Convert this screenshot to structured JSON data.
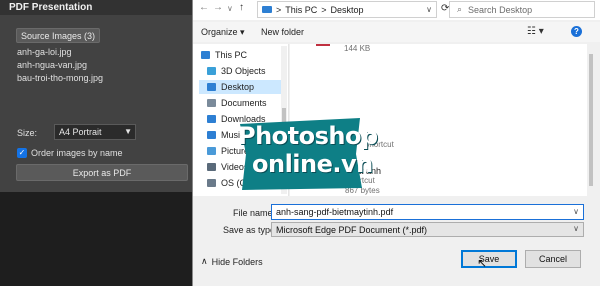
{
  "photoshop_panel": {
    "title": "PDF Presentation",
    "source_button": "Source Images (3)",
    "files": [
      "anh-ga-loi.jpg",
      "anh-ngua-van.jpg",
      "bau-troi-tho-mong.jpg"
    ],
    "size_label": "Size:",
    "size_value": "A4 Portrait",
    "order_label": "Order images by name",
    "order_checked": true,
    "export_button": "Export as PDF"
  },
  "dialog": {
    "address": {
      "segments": [
        "This PC",
        "Desktop"
      ],
      "separator": ">",
      "search_placeholder": "Search Desktop"
    },
    "toolbar": {
      "organize": "Organize ▾",
      "new_folder": "New folder"
    },
    "nav_items": [
      {
        "label": "This PC",
        "icon": "pc-icon",
        "color": "#2d7fd3"
      },
      {
        "label": "3D Objects",
        "icon": "cube-icon",
        "color": "#3aa0d8"
      },
      {
        "label": "Desktop",
        "icon": "desktop-icon",
        "color": "#2d7fd3",
        "selected": true
      },
      {
        "label": "Documents",
        "icon": "document-icon",
        "color": "#7a8a9a"
      },
      {
        "label": "Downloads",
        "icon": "download-icon",
        "color": "#2d7fd3"
      },
      {
        "label": "Music",
        "icon": "music-icon",
        "color": "#2d7fd3"
      },
      {
        "label": "Pictures",
        "icon": "picture-icon",
        "color": "#4a9ad8"
      },
      {
        "label": "Videos",
        "icon": "video-icon",
        "color": "#5a6a7a"
      },
      {
        "label": "OS (C:)",
        "icon": "drive-icon",
        "color": "#6a7a8a"
      }
    ],
    "files": {
      "top_size": "144 KB",
      "shortcut_label": "Shortcut",
      "folder_name": "Xuat anh",
      "folder_type": "Shortcut",
      "folder_size": "867 bytes"
    },
    "file_name_label": "File name:",
    "file_name_value": "anh-sang-pdf-bietmaytinh.pdf",
    "save_type_label": "Save as type:",
    "save_type_value": "Microsoft Edge PDF Document (*.pdf)",
    "hide_folders": "Hide Folders",
    "save_button": "Save",
    "cancel_button": "Cancel"
  },
  "watermark": {
    "line1": "Photoshop",
    "line2": "online.vn",
    "color": "#0e7f86"
  }
}
